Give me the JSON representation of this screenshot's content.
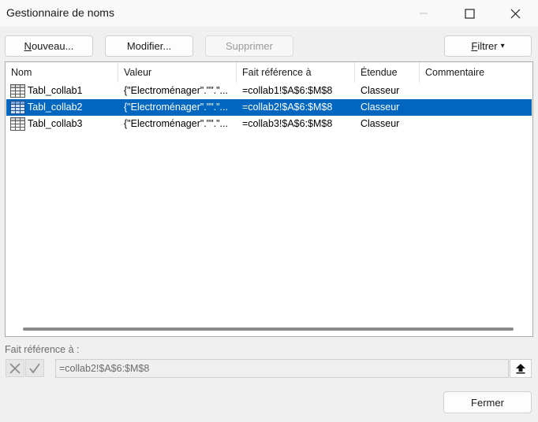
{
  "window": {
    "title": "Gestionnaire de noms"
  },
  "toolbar": {
    "new_first": "N",
    "new_rest": "ouveau...",
    "edit_first": "M",
    "edit_rest": "odifier...",
    "delete_label": "Supprimer",
    "filter_first": "F",
    "filter_rest": "iltrer",
    "filter_arrow": "▾"
  },
  "table": {
    "columns": [
      "Nom",
      "Valeur",
      "Fait référence à",
      "Étendue",
      "Commentaire"
    ],
    "rows": [
      {
        "name": "Tabl_collab1",
        "value": "{\"Electroménager\".\"\".\"...",
        "ref": "=collab1!$A$6:$M$8",
        "scope": "Classeur",
        "comment": ""
      },
      {
        "name": "Tabl_collab2",
        "value": "{\"Electroménager\".\"\".\"...",
        "ref": "=collab2!$A$6:$M$8",
        "scope": "Classeur",
        "comment": ""
      },
      {
        "name": "Tabl_collab3",
        "value": "{\"Electroménager\".\"\".\"...",
        "ref": "=collab3!$A$6:$M$8",
        "scope": "Classeur",
        "comment": ""
      }
    ],
    "selected_row_index": 1
  },
  "reference": {
    "label": "Fait référence à :",
    "value": "=collab2!$A$6:$M$8"
  },
  "footer": {
    "close_label": "Fermer"
  },
  "colors": {
    "selection": "#0067c0",
    "background": "#f0f0f0"
  },
  "icons": {
    "table": "table-icon",
    "cancel": "close-icon",
    "confirm": "check-icon",
    "collapse": "upload-arrow-icon"
  }
}
